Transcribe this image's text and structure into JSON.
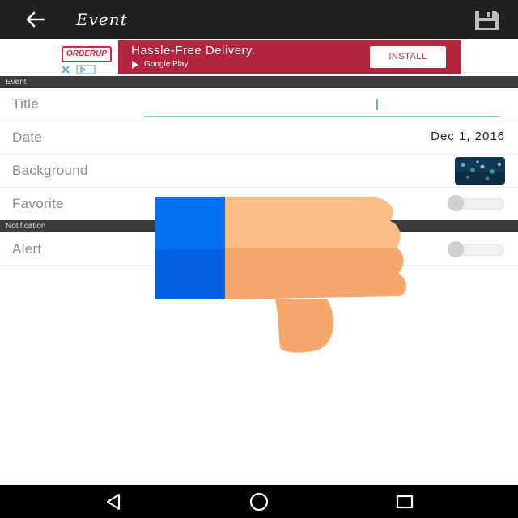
{
  "app_bar": {
    "title": "Event",
    "back_icon": "arrow-back-icon",
    "save_icon": "floppy-save-icon",
    "background": "#212121"
  },
  "ad": {
    "brand": "ORDERUP",
    "headline": "Hassle-Free Delivery.",
    "store_label": "Google Play",
    "cta_label": "INSTALL",
    "background": "#b3253a"
  },
  "sections": {
    "event": "Event",
    "notification": "Notification"
  },
  "fields": {
    "title_label": "Title",
    "title_value": "",
    "date_label": "Date",
    "date_value": "Dec 1, 2016",
    "background_label": "Background",
    "favorite_label": "Favorite",
    "favorite_on": false,
    "alert_label": "Alert",
    "alert_on": false
  },
  "overlay": {
    "icon": "thumbs-down-icon",
    "cuff_color": "#0064e0",
    "hand_color": "#f5a76c"
  },
  "nav_bar": {
    "back_icon": "nav-back-triangle-icon",
    "home_icon": "nav-home-circle-icon",
    "recents_icon": "nav-recents-square-icon"
  },
  "colors": {
    "accent": "#8fd0cf",
    "section_header": "#3c3c3c"
  }
}
